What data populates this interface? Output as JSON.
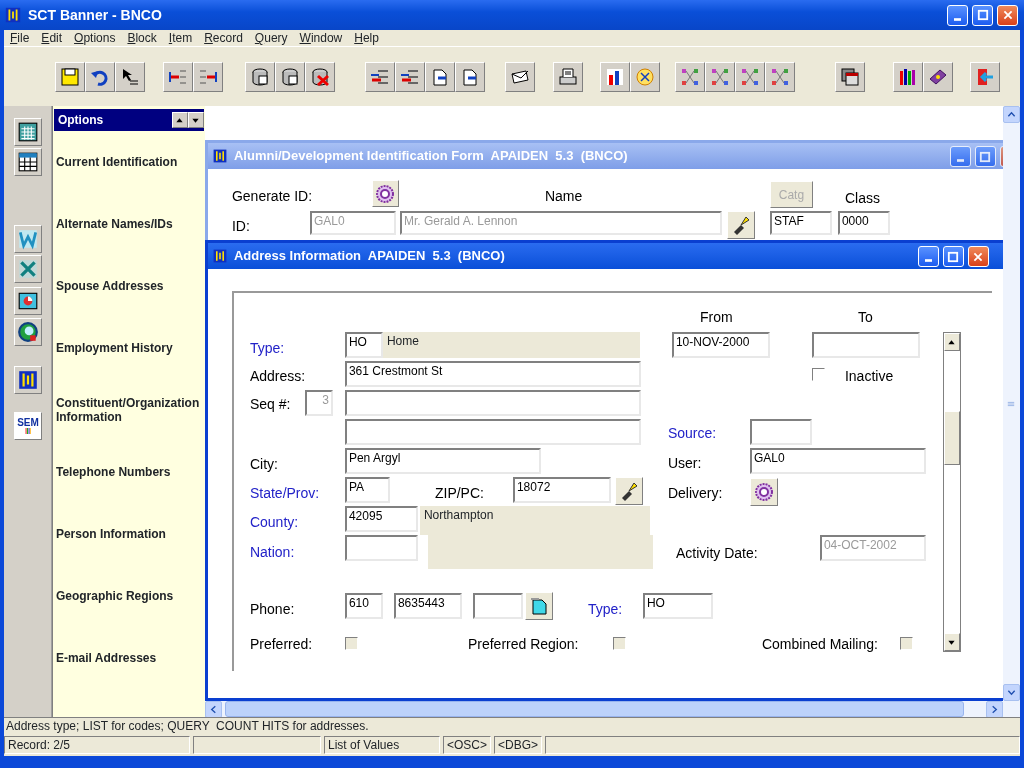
{
  "window": {
    "title": "SCT Banner - BNCO"
  },
  "menu": [
    "File",
    "Edit",
    "Options",
    "Block",
    "Item",
    "Record",
    "Query",
    "Window",
    "Help"
  ],
  "options_panel": {
    "title": "Options",
    "items": [
      "Current Identification",
      "Alternate Names/IDs",
      "Spouse Addresses",
      "Employment History",
      "Constituent/Organization Information",
      "Telephone Numbers",
      "Person Information",
      "Geographic Regions",
      "E-mail Addresses"
    ]
  },
  "sidebar_icon_label": "SEM",
  "forms": [
    {
      "title": "Alumni/Development Identification Form  APAIDEN  5.3  (BNCO)",
      "active": false,
      "items": [
        {
          "kind": "label",
          "text": "Generate ID:",
          "lov": false
        },
        {
          "kind": "button"
        },
        {
          "kind": "label",
          "text": "Name",
          "lov": false
        },
        {
          "kind": "button",
          "text": "Catg",
          "disabled": true
        },
        {
          "kind": "label",
          "text": "Class",
          "lov": false
        },
        {
          "kind": "label",
          "text": "ID:",
          "lov": false
        },
        {
          "kind": "field",
          "value": "GAL0",
          "disabled": true
        },
        {
          "kind": "field",
          "value": "Mr. Gerald A. Lennon",
          "disabled": true
        },
        {
          "kind": "button"
        },
        {
          "kind": "field",
          "value": "STAF",
          "disabled": false
        },
        {
          "kind": "field",
          "value": "0000",
          "disabled": false
        }
      ]
    },
    {
      "title": "Address Information  APAIDEN  5.3  (BNCO)",
      "active": true,
      "items": [
        {
          "kind": "label",
          "text": "From",
          "lov": false
        },
        {
          "kind": "label",
          "text": "To",
          "lov": false
        },
        {
          "kind": "label",
          "text": "Type:",
          "lov": true
        },
        {
          "kind": "field",
          "value": "HO",
          "disabled": false
        },
        {
          "kind": "display",
          "value": "Home"
        },
        {
          "kind": "field",
          "value": "10-NOV-2000",
          "disabled": false
        },
        {
          "kind": "field"
        },
        {
          "kind": "label",
          "text": "Address:",
          "lov": false
        },
        {
          "kind": "field",
          "value": "361 Crestmont St",
          "disabled": false
        },
        {
          "kind": "checkbox",
          "checked": false,
          "disabled": false
        },
        {
          "kind": "label",
          "text": "Inactive",
          "lov": false
        },
        {
          "kind": "label",
          "text": "Seq #:",
          "lov": false
        },
        {
          "kind": "field",
          "value": "3",
          "disabled": true
        },
        {
          "kind": "field"
        },
        {
          "kind": "field"
        },
        {
          "kind": "label",
          "text": "Source:",
          "lov": true
        },
        {
          "kind": "field"
        },
        {
          "kind": "label",
          "text": "City:",
          "lov": false
        },
        {
          "kind": "field",
          "value": "Pen Argyl",
          "disabled": false
        },
        {
          "kind": "label",
          "text": "User:",
          "lov": false
        },
        {
          "kind": "field",
          "value": "GAL0",
          "disabled": false
        },
        {
          "kind": "label",
          "text": "State/Prov:",
          "lov": true
        },
        {
          "kind": "field",
          "value": "PA",
          "disabled": false
        },
        {
          "kind": "label",
          "text": "ZIP/PC:",
          "lov": false
        },
        {
          "kind": "field",
          "value": "18072",
          "disabled": false
        },
        {
          "kind": "button"
        },
        {
          "kind": "label",
          "text": "Delivery:",
          "lov": false
        },
        {
          "kind": "button"
        },
        {
          "kind": "label",
          "text": "County:",
          "lov": true
        },
        {
          "kind": "field",
          "value": "42095",
          "disabled": false
        },
        {
          "kind": "display",
          "value": "Northampton"
        },
        {
          "kind": "label",
          "text": "Nation:",
          "lov": true
        },
        {
          "kind": "field"
        },
        {
          "kind": "display"
        },
        {
          "kind": "label",
          "text": "Activity Date:",
          "lov": false
        },
        {
          "kind": "field",
          "value": "04-OCT-2002",
          "disabled": true
        },
        {
          "kind": "label",
          "text": "Phone:",
          "lov": false
        },
        {
          "kind": "field",
          "value": "610",
          "disabled": false
        },
        {
          "kind": "field",
          "value": "8635443",
          "disabled": false
        },
        {
          "kind": "field"
        },
        {
          "kind": "button"
        },
        {
          "kind": "label",
          "text": "Type:",
          "lov": true
        },
        {
          "kind": "field",
          "value": "HO",
          "disabled": false
        },
        {
          "kind": "label",
          "text": "Preferred:",
          "lov": false
        },
        {
          "kind": "checkbox",
          "checked": false,
          "disabled": true
        },
        {
          "kind": "label",
          "text": "Preferred Region:",
          "lov": false
        },
        {
          "kind": "checkbox",
          "checked": false,
          "disabled": true
        },
        {
          "kind": "label",
          "text": "Combined Mailing:",
          "lov": false
        },
        {
          "kind": "checkbox",
          "checked": false,
          "disabled": true
        }
      ]
    }
  ],
  "message": "Address type; LIST for codes; QUERY  COUNT HITS for addresses.",
  "status_bar": [
    "Record: 2/5",
    "List of Values",
    "<OSC>",
    "<DBG>"
  ]
}
